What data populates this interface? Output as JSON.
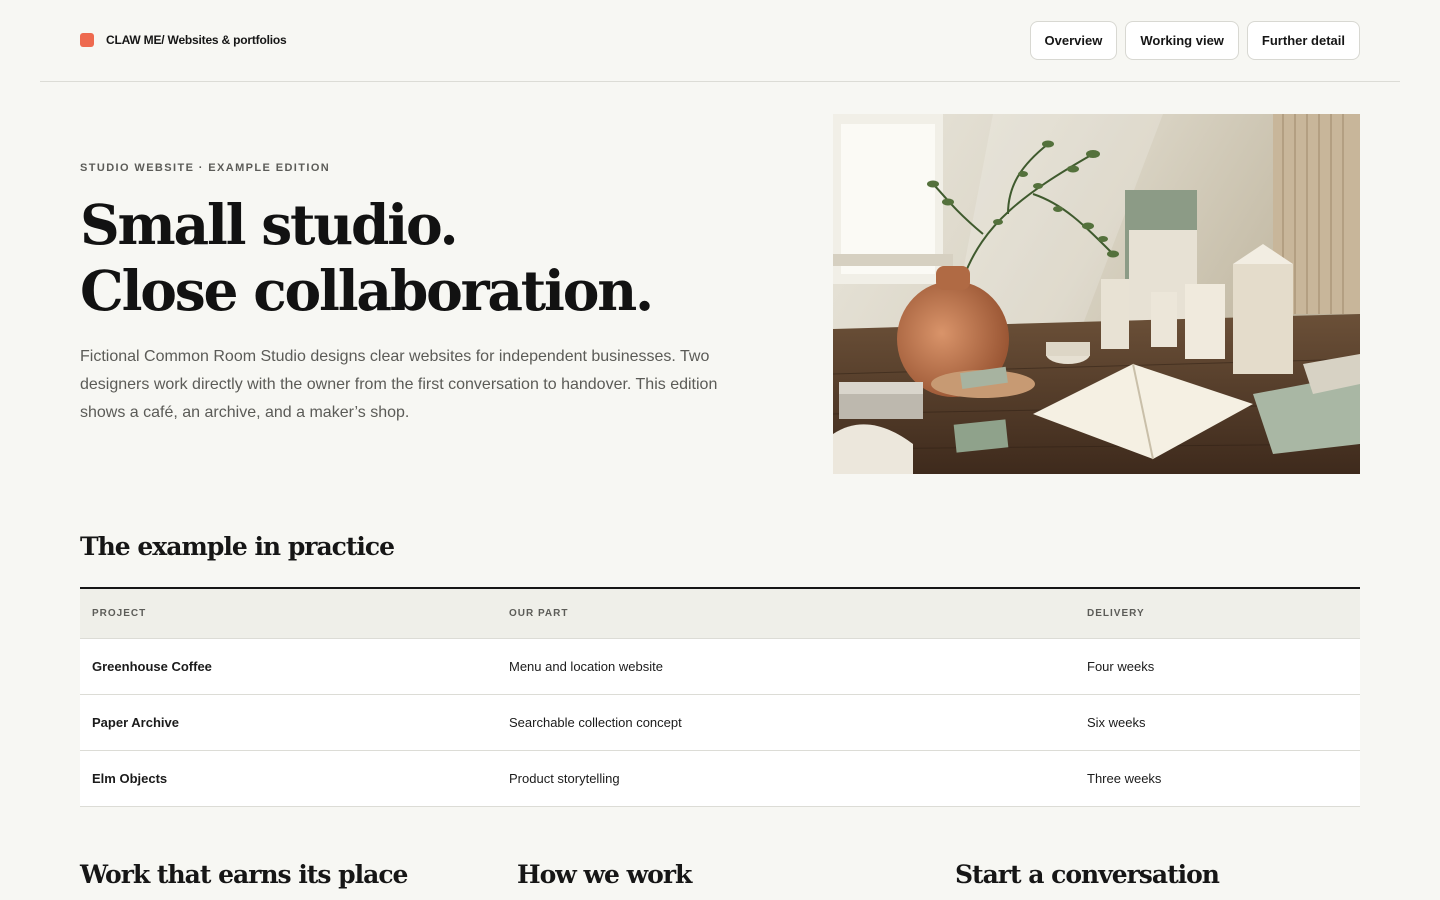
{
  "header": {
    "brand": "CLAW ME/ Websites & portfolios",
    "brand_color": "#ee6a4f",
    "nav": [
      "Overview",
      "Working view",
      "Further detail"
    ]
  },
  "hero": {
    "eyebrow": "STUDIO WEBSITE · EXAMPLE EDITION",
    "title_line_1": "Small studio.",
    "title_line_2": "Close collaboration.",
    "description": "Fictional Common Room Studio designs clear websites for independent businesses. Two designers work directly with the owner from the first conversation to handover. This edition shows a café, an archive, and a maker’s shop.",
    "image": "studio-still-life-photo"
  },
  "practice": {
    "title": "The example in practice",
    "columns": [
      "PROJECT",
      "OUR PART",
      "DELIVERY"
    ],
    "rows": [
      [
        "Greenhouse Coffee",
        "Menu and location website",
        "Four weeks"
      ],
      [
        "Paper Archive",
        "Searchable collection concept",
        "Six weeks"
      ],
      [
        "Elm Objects",
        "Product storytelling",
        "Three weeks"
      ]
    ]
  },
  "sections": [
    "Work that earns its place",
    "How we work",
    "Start a conversation"
  ]
}
